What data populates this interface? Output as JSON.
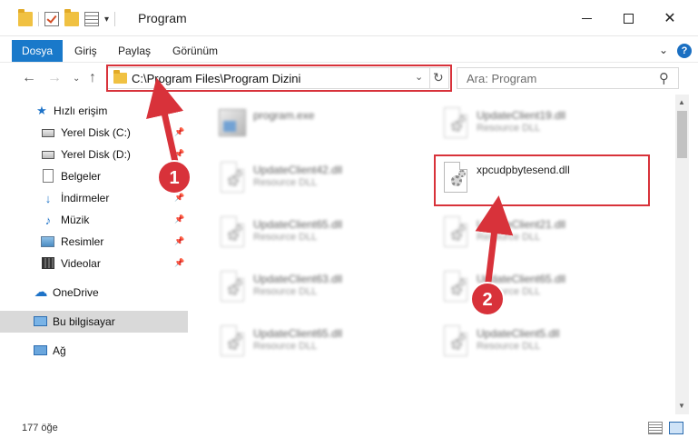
{
  "window": {
    "title": "Program",
    "minimize_glyph": "",
    "maximize_glyph": "",
    "close_glyph": "✕"
  },
  "quick_access_toolbar": {
    "dropdown_glyph": "▾"
  },
  "ribbon": {
    "tabs": [
      {
        "label": "Dosya",
        "active": true
      },
      {
        "label": "Giriş"
      },
      {
        "label": "Paylaş"
      },
      {
        "label": "Görünüm"
      }
    ],
    "expand_glyph": "⌄",
    "help_glyph": "?"
  },
  "navigation": {
    "back_glyph": "←",
    "forward_glyph": "→",
    "recent_glyph": "⌄",
    "up_glyph": "↑"
  },
  "address_bar": {
    "path": "C:\\Program Files\\Program Dizini",
    "dropdown_glyph": "⌄",
    "refresh_glyph": "↻"
  },
  "search": {
    "placeholder": "Ara: Program",
    "icon_glyph": "⚲"
  },
  "nav_pane": {
    "items": [
      {
        "label": "Hızlı erişim",
        "icon": "star-icon"
      },
      {
        "label": "Yerel Disk (C:)",
        "icon": "drive-icon",
        "pinned": true
      },
      {
        "label": "Yerel Disk (D:)",
        "icon": "drive-icon",
        "pinned": true
      },
      {
        "label": "Belgeler",
        "icon": "document-icon",
        "pinned": true
      },
      {
        "label": "İndirmeler",
        "icon": "download-icon",
        "pinned": true
      },
      {
        "label": "Müzik",
        "icon": "music-icon",
        "pinned": true
      },
      {
        "label": "Resimler",
        "icon": "pictures-icon",
        "pinned": true
      },
      {
        "label": "Videolar",
        "icon": "video-icon",
        "pinned": true
      },
      {
        "label": "OneDrive",
        "icon": "cloud-icon"
      },
      {
        "label": "Bu bilgisayar",
        "icon": "computer-icon",
        "selected": true
      },
      {
        "label": "Ağ",
        "icon": "network-icon"
      }
    ],
    "pin_glyph": "📌",
    "star_glyph": "★",
    "cloud_glyph": "☁",
    "music_glyph": "♪",
    "download_glyph": "↓"
  },
  "files": {
    "left_column": [
      {
        "name": "program.exe",
        "type": ""
      },
      {
        "name": "UpdateClient42.dll",
        "type": "Resource DLL"
      },
      {
        "name": "UpdateClient65.dll",
        "type": "Resource DLL"
      },
      {
        "name": "UpdateClient63.dll",
        "type": "Resource DLL"
      },
      {
        "name": "UpdateClient65.dll",
        "type": "Resource DLL"
      }
    ],
    "right_column": [
      {
        "name": "UpdateClient19.dll",
        "type": "Resource DLL"
      },
      {
        "name": "xpcudpbytesend.dll",
        "type": ""
      },
      {
        "name": "UpdateClient21.dll",
        "type": "Resource DLL"
      },
      {
        "name": "UpdateClient65.dll",
        "type": "Resource DLL"
      },
      {
        "name": "UpdateClient5.dll",
        "type": "Resource DLL"
      }
    ]
  },
  "scrollbar": {
    "up_glyph": "▲",
    "down_glyph": "▼"
  },
  "status_bar": {
    "item_count": "177 öğe"
  },
  "annotations": {
    "badges": [
      {
        "label": "1"
      },
      {
        "label": "2"
      }
    ]
  },
  "colors": {
    "accent": "#1979ca",
    "annotation_red": "#d8323a",
    "selection_grey": "#d9d9d9"
  }
}
